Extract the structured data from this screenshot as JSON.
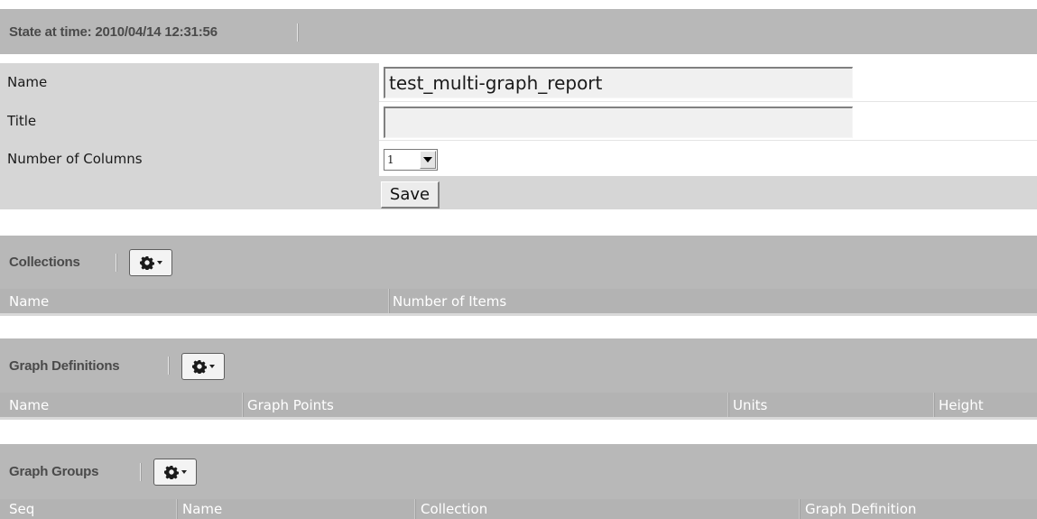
{
  "state_header": {
    "title": "State at time: 2010/04/14 12:31:56"
  },
  "form": {
    "name_label": "Name",
    "name_value": "test_multi-graph_report",
    "title_label": "Title",
    "title_value": "",
    "columns_label": "Number of Columns",
    "columns_value": "1",
    "save_label": "Save"
  },
  "collections": {
    "title": "Collections",
    "columns": [
      "Name",
      "Number of Items"
    ]
  },
  "graph_definitions": {
    "title": "Graph Definitions",
    "columns": [
      "Name",
      "Graph Points",
      "Units",
      "Height"
    ]
  },
  "graph_groups": {
    "title": "Graph Groups",
    "columns": [
      "Seq",
      "Name",
      "Collection",
      "Graph Definition"
    ]
  },
  "icons": {
    "gear": "gear-icon",
    "caret": "chevron-down-icon"
  }
}
